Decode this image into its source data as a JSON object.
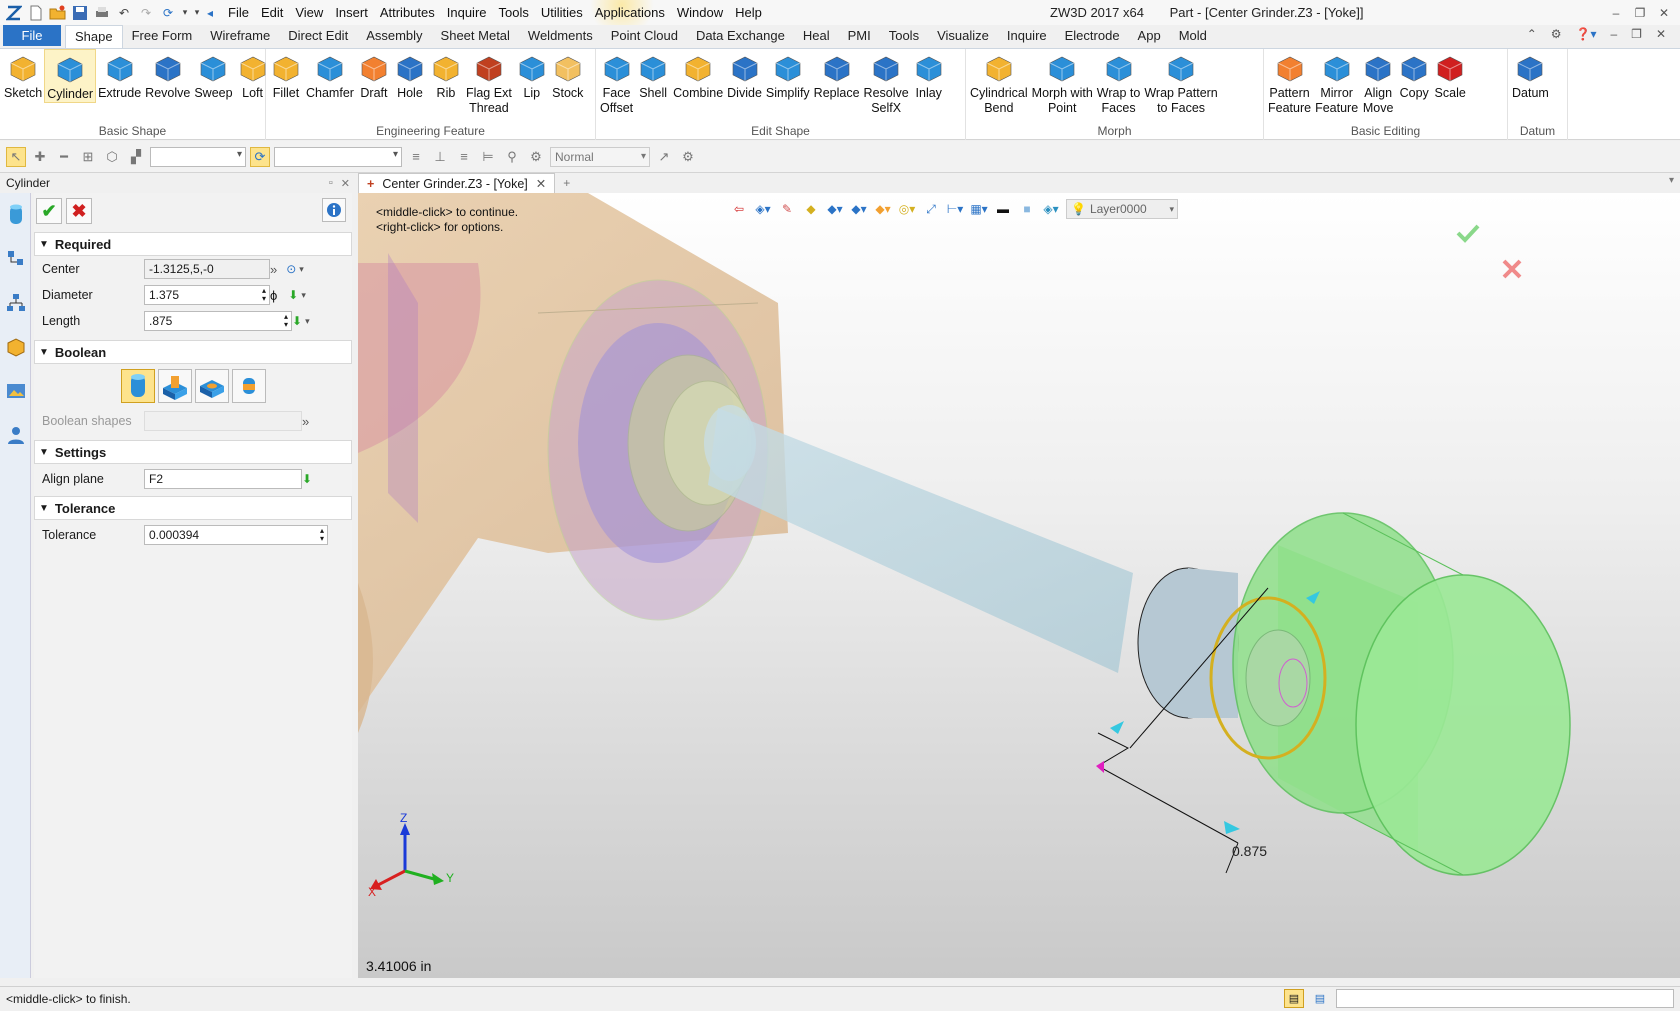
{
  "titlebar": {
    "menus": [
      "File",
      "Edit",
      "View",
      "Insert",
      "Attributes",
      "Inquire",
      "Tools",
      "Utilities",
      "Applications",
      "Window",
      "Help"
    ],
    "app_title": "ZW3D 2017  x64",
    "doc_title": "Part - [Center Grinder.Z3 - [Yoke]]"
  },
  "ribbon": {
    "file_label": "File",
    "tabs": [
      "Shape",
      "Free Form",
      "Wireframe",
      "Direct Edit",
      "Assembly",
      "Sheet Metal",
      "Weldments",
      "Point Cloud",
      "Data Exchange",
      "Heal",
      "PMI",
      "Tools",
      "Visualize",
      "Inquire",
      "Electrode",
      "App",
      "Mold"
    ],
    "groups": {
      "basic_shape": {
        "label": "Basic Shape",
        "buttons": [
          "Sketch",
          "Cylinder",
          "Extrude",
          "Revolve",
          "Sweep",
          "Loft"
        ]
      },
      "engineering": {
        "label": "Engineering Feature",
        "buttons": [
          "Fillet",
          "Chamfer",
          "Draft",
          "Hole",
          "Rib",
          "Flag Ext\nThread",
          "Lip",
          "Stock"
        ]
      },
      "edit_shape": {
        "label": "Edit Shape",
        "buttons": [
          "Face\nOffset",
          "Shell",
          "Combine",
          "Divide",
          "Simplify",
          "Replace",
          "Resolve\nSelfX",
          "Inlay"
        ]
      },
      "morph": {
        "label": "Morph",
        "buttons": [
          "Cylindrical\nBend",
          "Morph with\nPoint",
          "Wrap to\nFaces",
          "Wrap Pattern\nto Faces"
        ]
      },
      "basic_editing": {
        "label": "Basic Editing",
        "buttons": [
          "Pattern\nFeature",
          "Mirror\nFeature",
          "Align\nMove",
          "Copy",
          "Scale"
        ]
      },
      "datum": {
        "label": "Datum",
        "buttons": [
          "Datum"
        ]
      }
    }
  },
  "toolbar": {
    "render_mode": "Normal"
  },
  "panel": {
    "title": "Cylinder",
    "required": {
      "header": "Required",
      "center_label": "Center",
      "center_value": "-1.3125,5,-0",
      "diameter_label": "Diameter",
      "diameter_value": "1.375",
      "length_label": "Length",
      "length_value": ".875"
    },
    "boolean": {
      "header": "Boolean",
      "shapes_label": "Boolean shapes"
    },
    "settings": {
      "header": "Settings",
      "align_label": "Align plane",
      "align_value": "F2"
    },
    "tolerance": {
      "header": "Tolerance",
      "tol_label": "Tolerance",
      "tol_value": "0.000394"
    }
  },
  "viewport": {
    "doc_tab": "Center Grinder.Z3 - [Yoke]",
    "layer": "Layer0000",
    "hint1": "<middle-click> to continue.",
    "hint2": "<right-click> for options.",
    "measure": "3.41006 in",
    "dimension": "0.875",
    "axes": {
      "x": "X",
      "y": "Y",
      "z": "Z"
    }
  },
  "status": {
    "message": "<middle-click> to finish."
  },
  "colors": {
    "accent": "#2b73c6",
    "preview_green": "#8fe08a",
    "selection_yellow": "#d4b020"
  }
}
